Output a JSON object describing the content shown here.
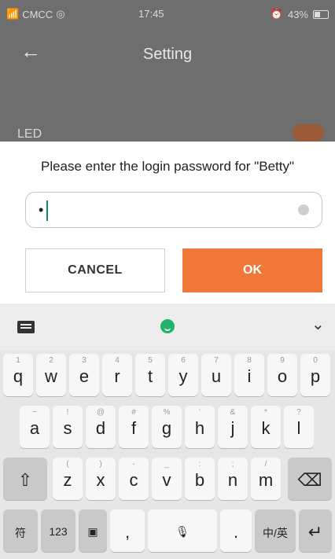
{
  "status_bar": {
    "carrier": "CMCC",
    "time": "17:45",
    "battery": "43%"
  },
  "background_screen": {
    "title": "Setting",
    "row_label": "LED"
  },
  "dialog": {
    "prompt": "Please enter the login password for \"Betty\"",
    "password_mask": "•",
    "cancel_label": "CANCEL",
    "ok_label": "OK",
    "ok_color": "#f07838"
  },
  "keyboard": {
    "hide_label": "⌄",
    "row1": [
      {
        "hint": "1",
        "key": "q"
      },
      {
        "hint": "2",
        "key": "w"
      },
      {
        "hint": "3",
        "key": "e"
      },
      {
        "hint": "4",
        "key": "r"
      },
      {
        "hint": "5",
        "key": "t"
      },
      {
        "hint": "6",
        "key": "y"
      },
      {
        "hint": "7",
        "key": "u"
      },
      {
        "hint": "8",
        "key": "i"
      },
      {
        "hint": "9",
        "key": "o"
      },
      {
        "hint": "0",
        "key": "p"
      }
    ],
    "row2": [
      {
        "hint": "~",
        "key": "a"
      },
      {
        "hint": "!",
        "key": "s"
      },
      {
        "hint": "@",
        "key": "d"
      },
      {
        "hint": "#",
        "key": "f"
      },
      {
        "hint": "%",
        "key": "g"
      },
      {
        "hint": "'",
        "key": "h"
      },
      {
        "hint": "&",
        "key": "j"
      },
      {
        "hint": "*",
        "key": "k"
      },
      {
        "hint": "?",
        "key": "l"
      }
    ],
    "row3": [
      {
        "hint": "(",
        "key": "z"
      },
      {
        "hint": ")",
        "key": "x"
      },
      {
        "hint": "-",
        "key": "c"
      },
      {
        "hint": "_",
        "key": "v"
      },
      {
        "hint": ":",
        "key": "b"
      },
      {
        "hint": ";",
        "key": "n"
      },
      {
        "hint": "/",
        "key": "m"
      }
    ],
    "shift_label": "⇧",
    "backspace_label": "⌫",
    "bottom": {
      "symbols": "符",
      "numbers": "123",
      "clipboard": "▣",
      "comma": ",",
      "space": "🎙",
      "period": ".",
      "lang": "中/英",
      "enter": "↵"
    }
  }
}
